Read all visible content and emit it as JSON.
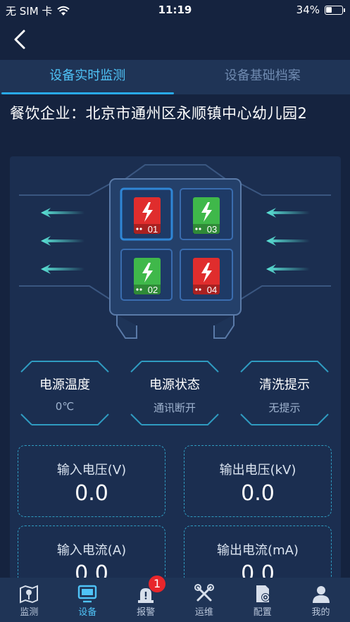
{
  "status_bar": {
    "carrier": "无 SIM 卡",
    "time": "11:19",
    "battery": "34%"
  },
  "tabs": [
    {
      "label": "设备实时监测",
      "active": true
    },
    {
      "label": "设备基础档案",
      "active": false
    }
  ],
  "company": {
    "label": "餐饮企业：北京市通州区永顺镇中心幼儿园2"
  },
  "modules": [
    {
      "id": "01",
      "status_color": "#e02d2d"
    },
    {
      "id": "03",
      "status_color": "#3fb84a"
    },
    {
      "id": "02",
      "status_color": "#3fb84a"
    },
    {
      "id": "04",
      "status_color": "#e02d2d"
    }
  ],
  "stats": [
    {
      "title": "电源温度",
      "value": "0℃"
    },
    {
      "title": "电源状态",
      "value": "通讯断开"
    },
    {
      "title": "清洗提示",
      "value": "无提示"
    }
  ],
  "metrics": [
    {
      "label": "输入电压(V)",
      "value": "0.0"
    },
    {
      "label": "输出电压(kV)",
      "value": "0.0"
    },
    {
      "label": "输入电流(A)",
      "value": "0.0"
    },
    {
      "label": "输出电流(mA)",
      "value": "0.0"
    }
  ],
  "bottom_nav": [
    {
      "label": "监测",
      "icon": "map-icon"
    },
    {
      "label": "设备",
      "icon": "monitor-icon",
      "active": true
    },
    {
      "label": "报警",
      "icon": "alarm-icon",
      "badge": "1"
    },
    {
      "label": "运维",
      "icon": "tools-icon"
    },
    {
      "label": "配置",
      "icon": "config-icon"
    },
    {
      "label": "我的",
      "icon": "user-icon"
    }
  ],
  "colors": {
    "background": "#15233f",
    "accent": "#4fc3f7",
    "red": "#e02d2d",
    "green": "#3fb84a"
  }
}
